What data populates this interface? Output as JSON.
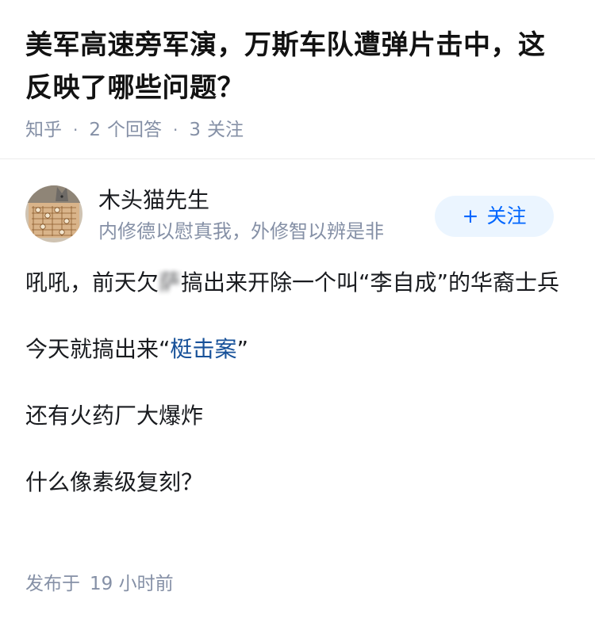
{
  "question": {
    "title": "美军高速旁军演，万斯车队遭弹片击中，这反映了哪些问题？",
    "source": "知乎",
    "answer_count": "2",
    "answer_label": "个回答",
    "follow_count": "3",
    "follow_label": "关注"
  },
  "answer": {
    "author": {
      "name": "木头猫先生",
      "bio": "内修德以慰真我，外修智以辨是非",
      "avatar_icon": "chess-board-cat-avatar"
    },
    "follow_button": {
      "plus": "+",
      "label": "关注"
    },
    "paragraphs": {
      "p1_prefix": "吼吼，前天欠",
      "p1_blur": "萨",
      "p1_suffix": "搞出来开除一个叫“李自成”的华裔士兵",
      "p2_prefix": "今天就搞出来“",
      "p2_link": "梃击案",
      "p2_suffix": "”",
      "p3": "还有火药厂大爆炸",
      "p4": "什么像素级复刻？"
    },
    "publish": {
      "label": "发布于",
      "time": "19 小时前"
    }
  },
  "colors": {
    "brand_blue": "#0066ff",
    "link_blue": "#175199",
    "meta_gray": "#8590a6",
    "follow_bg": "#ebf5ff"
  }
}
